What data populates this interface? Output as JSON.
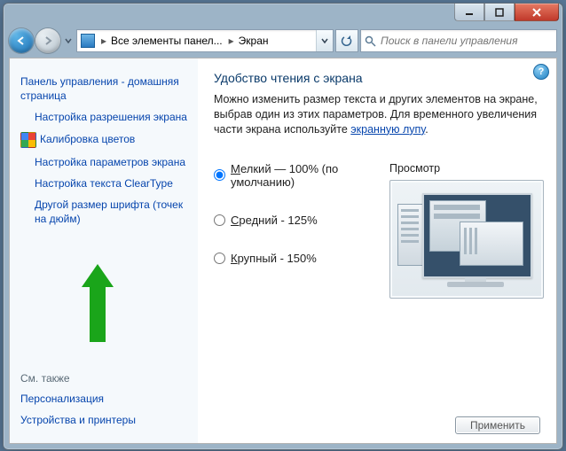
{
  "window": {
    "breadcrumb": {
      "seg1": "Все элементы панели управления",
      "seg1_short": "Все элементы панел",
      "seg2": "Экран"
    },
    "search_placeholder": "Поиск в панели управления"
  },
  "sidebar": {
    "home": "Панель управления - домашняя страница",
    "items": [
      "Настройка разрешения экрана",
      "Калибровка цветов",
      "Настройка параметров экрана",
      "Настройка текста ClearType",
      "Другой размер шрифта (точек на дюйм)"
    ],
    "also_label": "См. также",
    "also_items": [
      "Персонализация",
      "Устройства и принтеры"
    ]
  },
  "main": {
    "title": "Удобство чтения с экрана",
    "desc_pre": "Можно изменить размер текста и других элементов на экране, выбрав один из этих параметров. Для временного увеличения части экрана используйте ",
    "desc_link": "экранную лупу",
    "desc_post": ".",
    "options": {
      "small": {
        "u": "М",
        "rest": "елкий — 100% (по умолчанию)"
      },
      "medium": {
        "u": "С",
        "rest": "редний - 125%"
      },
      "large": {
        "u": "К",
        "rest": "рупный - 150%"
      }
    },
    "preview_label": "Просмотр",
    "apply_label": "Применить"
  }
}
